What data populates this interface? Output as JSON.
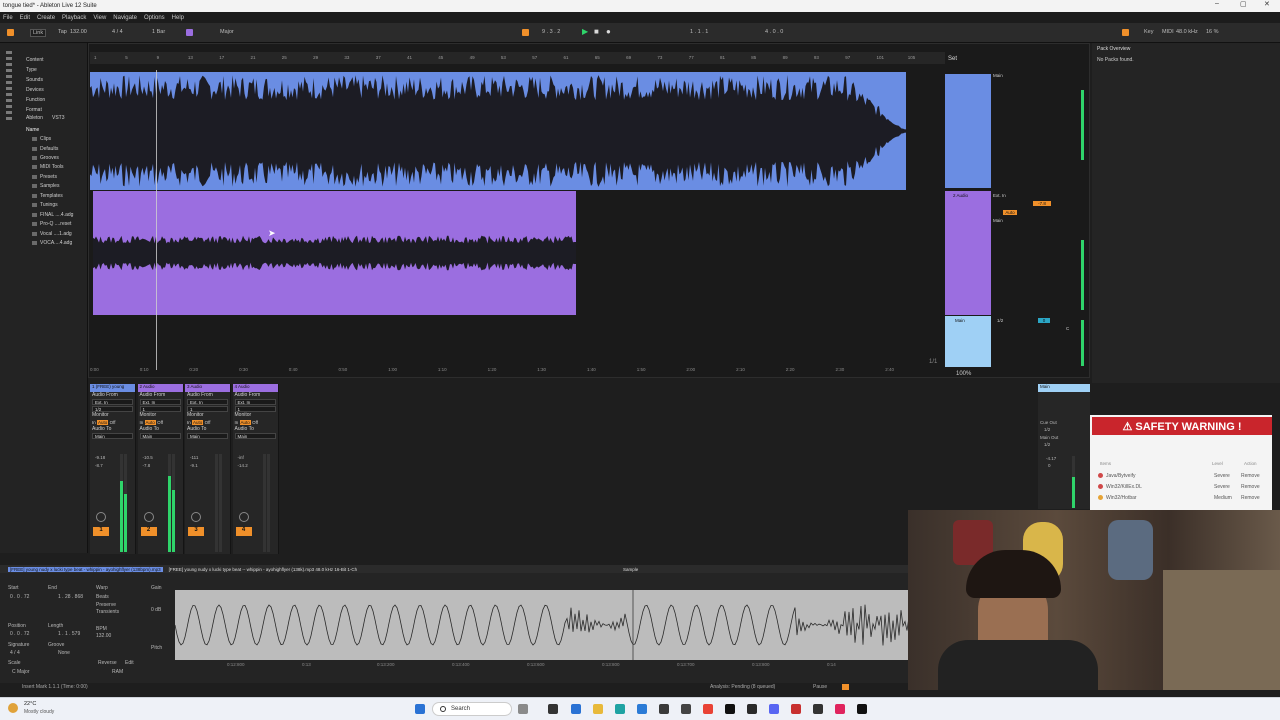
{
  "window": {
    "title": "tongue tied* - Ableton Live 12 Suite"
  },
  "menu": [
    "File",
    "Edit",
    "Create",
    "Playback",
    "View",
    "Navigate",
    "Options",
    "Help"
  ],
  "control_bar": {
    "link": "Link",
    "tap": "Tap",
    "tempo": "132.00",
    "meter": "4 / 4",
    "quantize": "1 Bar",
    "key": "Major",
    "position": "9 . 3 . 2",
    "loop_start": "1 . 1 . 1",
    "loop_length": "4 . 0 . 0",
    "key_label": "Key",
    "midi_label": "MIDI",
    "sample_rate": "48.0 kHz",
    "cpu": "16 %"
  },
  "browser": {
    "categories": [
      "Content",
      "Type",
      "Sounds",
      "Devices",
      "Function",
      "Format",
      "Ableton",
      "VST3"
    ],
    "places_header": "Name",
    "items": [
      "Clips",
      "Defaults",
      "Grooves",
      "MIDI Tools",
      "Presets",
      "Samples",
      "Templates",
      "Tunings",
      "FINAL ....4.adg",
      "Pro-Q ....reset",
      "Vocal ....1.adg",
      "VOCA....4.adg"
    ]
  },
  "arrangement": {
    "ruler": [
      "1",
      "5",
      "9",
      "13",
      "17",
      "21",
      "25",
      "29",
      "33",
      "37",
      "41",
      "45",
      "49",
      "53",
      "57",
      "61",
      "65",
      "69",
      "73",
      "77",
      "81",
      "85",
      "89",
      "93",
      "97",
      "101",
      "105"
    ],
    "time_ticks": [
      "0:00",
      "0:10",
      "0:20",
      "0:30",
      "0:40",
      "0:50",
      "1:00",
      "1:10",
      "1:20",
      "1:30",
      "1:40",
      "1:50",
      "2:00",
      "2:10",
      "2:20",
      "2:30",
      "2:40"
    ],
    "set_label": "Set",
    "page_count": "1/1",
    "zoom": "100%",
    "tracks": [
      {
        "name": "1 (FREE) young",
        "routing": "Main",
        "color": "#6a8de3"
      },
      {
        "name": "2 Audio",
        "routing": "Main",
        "input": "Ext. In",
        "monitor": "Auto",
        "volume": "-7.8",
        "color": "#9b6ee0"
      },
      {
        "name": "Main",
        "routing": "1/2",
        "volume": "0",
        "pan": "C",
        "color": "#9fd0f5"
      }
    ]
  },
  "pack_overview": {
    "title": "Pack Overview",
    "message": "No Packs found."
  },
  "mixer": {
    "strips": [
      {
        "header": "1 (FREE) young",
        "audio_from": "Audio From",
        "input": "Ext. In",
        "channel": "1/2",
        "monitor_label": "Monitor",
        "monitor_in": "In",
        "monitor_auto": "Auto",
        "monitor_off": "Off",
        "audio_to": "Audio To",
        "output": "Main",
        "vol": "-9.18",
        "peak": "-8.7",
        "number": "1",
        "level": 0.72
      },
      {
        "header": "2 Audio",
        "audio_from": "Audio From",
        "input": "Ext. In",
        "channel": "1",
        "monitor_label": "Monitor",
        "monitor_in": "In",
        "monitor_auto": "Auto",
        "monitor_off": "Off",
        "audio_to": "Audio To",
        "output": "Main",
        "vol": "-10.5",
        "peak": "-7.8",
        "number": "2",
        "level": 0.78
      },
      {
        "header": "3 Audio",
        "audio_from": "Audio From",
        "input": "Ext. In",
        "channel": "1",
        "monitor_label": "Monitor",
        "monitor_in": "In",
        "monitor_auto": "Auto",
        "monitor_off": "Off",
        "audio_to": "Audio To",
        "output": "Main",
        "vol": "-111",
        "peak": "-9.1",
        "number": "3",
        "level": 0.0
      },
      {
        "header": "4 Audio",
        "audio_from": "Audio From",
        "input": "Ext. In",
        "channel": "1",
        "monitor_label": "Monitor",
        "monitor_in": "In",
        "monitor_auto": "Auto",
        "monitor_off": "Off",
        "audio_to": "Audio To",
        "output": "Main",
        "vol": "-inf",
        "peak": "-14.2",
        "number": "4",
        "level": 0.0
      }
    ],
    "main": {
      "header": "Main",
      "cue_out": "Cue Out",
      "cue_ch": "1/2",
      "main_out": "Main Out",
      "main_ch": "1/2",
      "vol": "-4.17",
      "peak": "0",
      "level": 0.6
    }
  },
  "clip_view": {
    "title": "[FREE] young nudy x lucki type beat - whippin - ayohighflyer (138bpm).mp3",
    "sample_info": "[FREE] young nudy x lucki type beat -- whippin - ayohighflyer (138k).mp3 48.0 kHz 16-Bit 1-Ch",
    "tab_sample": "Sample",
    "start_label": "Start",
    "start": "0 . 0 . 72",
    "end_label": "End",
    "end": "1 . 28 . 868",
    "position_label": "Position",
    "position": "0 . 0 . 72",
    "length_label": "Length",
    "length": "1 . 1 . 579",
    "signature_label": "Signature",
    "signature": "4 / 4",
    "groove_label": "Groove",
    "groove": "None",
    "scale_label": "Scale",
    "scale": "C Major",
    "warp": "Warp",
    "mode": "Beats",
    "preserve": "Preserve",
    "transients": "Transients",
    "bpm_label": "BPM",
    "bpm": "132.00",
    "reverse": "Reverse",
    "edit": "Edit",
    "ram": "RAM",
    "gain_label": "Gain",
    "gain": "0 dB",
    "pitch_label": "Pitch",
    "time_ticks": [
      "0:12:800",
      "0:13",
      "0:13:200",
      "0:13:400",
      "0:13:600",
      "0:13:800",
      "0:13:700",
      "0:13:800",
      "0:14"
    ]
  },
  "status": {
    "left": "Insert Mark 1.1.1 (Time: 0:00)",
    "right": "Analysis: Pending (8 queued)",
    "pause": "Pause"
  },
  "safety_warning": {
    "title": "⚠ SAFETY WARNING !",
    "columns": [
      "Items",
      "Level",
      "Action"
    ],
    "rows": [
      {
        "item": "Java/Bytveify",
        "level": "Severe",
        "action": "Remove"
      },
      {
        "item": "Win32/KillEx.DL",
        "level": "Severe",
        "action": "Remove"
      },
      {
        "item": "Win32/Hotbar",
        "level": "Medium",
        "action": "Remove"
      }
    ]
  },
  "taskbar": {
    "weather_temp": "22°C",
    "weather_desc": "Mostly cloudy",
    "search": "Search"
  }
}
